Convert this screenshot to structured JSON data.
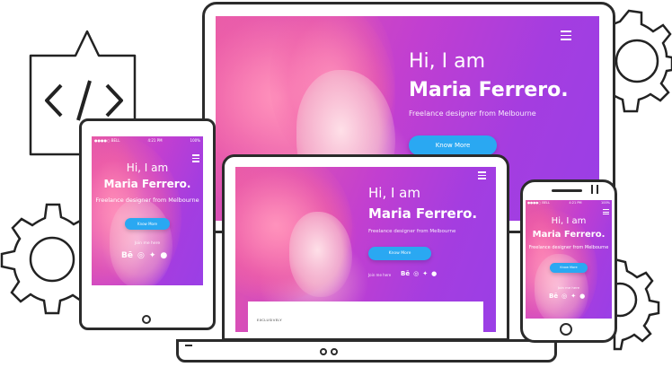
{
  "hero": {
    "greeting": "Hi, I am",
    "name": "Maria Ferrero.",
    "tagline": "Freelance designer from Melbourne",
    "cta_label": "Know More",
    "join_label": "Join me here",
    "section_label": "EXCLUSIVELY"
  },
  "status_bar": {
    "carrier": "●●●●○ BELL",
    "time": "4:21 PM",
    "battery": "100%"
  },
  "social": [
    {
      "icon": "behance-icon",
      "glyph": "Bē"
    },
    {
      "icon": "dribbble-icon",
      "glyph": "◎"
    },
    {
      "icon": "twitter-icon",
      "glyph": "✦"
    },
    {
      "icon": "github-icon",
      "glyph": "●"
    }
  ],
  "colors": {
    "accent": "#2aa8f2",
    "gradient_start": "#e85aa6",
    "gradient_end": "#9a3fe6",
    "device_frame": "#2b2b2b"
  }
}
